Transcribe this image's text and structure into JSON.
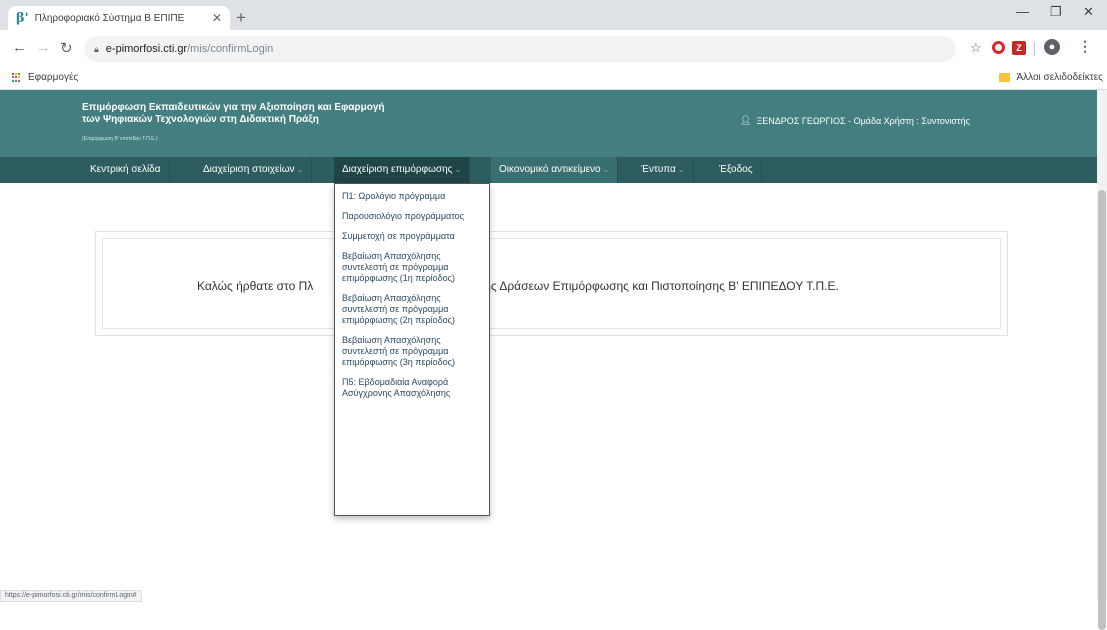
{
  "browser": {
    "tab": {
      "favicon_text": "β'",
      "title": "Πληροφοριακό Σύστημα Β ΕΠΙΠΕ"
    },
    "address": {
      "host": "e-pimorfosi.cti.gr",
      "path": "/mis/confirmLogin"
    },
    "bookmarks": {
      "apps_label": "Εφαρμογές",
      "other_label": "Άλλοι σελιδοδείκτες"
    },
    "status_url": "https://e-pimorfosi.cti.gr/mis/confirmLogin#"
  },
  "header": {
    "title_line1": "Επιμόρφωση Εκπαιδευτικών για την Αξιοποίηση και Εφαρμογή",
    "title_line2": "των Ψηφιακών Τεχνολογιών στη Διδακτική Πράξη",
    "subtitle": "(Επιμόρφωση Β' επιπέδου Τ.Π.Ε.)",
    "user_text": "ΞΕΝΔΡΟΣ ΓΕΩΡΓΙΟΣ - Ομάδα Χρήστη : Συντονιστής"
  },
  "nav": {
    "items": [
      {
        "label": "Κεντρική σελίδα",
        "has_chevron": false
      },
      {
        "label": "Διαχείριση στοιχείων",
        "has_chevron": true
      },
      {
        "label": "Διαχείριση επιμόρφωσης",
        "has_chevron": true
      },
      {
        "label": "Οικονομικό αντικείμενο",
        "has_chevron": true
      },
      {
        "label": "Έντυπα",
        "has_chevron": true
      },
      {
        "label": "Έξοδος",
        "has_chevron": false
      }
    ]
  },
  "dropdown": {
    "items": [
      "Π1: Ωρολόγιο πρόγραμμα",
      "Παρουσιολόγιο προγράμματος",
      "Συμμετοχή σε προγράμματα",
      "Βεβαίωση Απασχόλησης συντελεστή σε πρόγραμμα επιμόρφωσης (1η περίοδος)",
      "Βεβαίωση Απασχόλησης συντελεστή σε πρόγραμμα επιμόρφωσης (2η περίοδος)",
      "Βεβαίωση Απασχόλησης συντελεστή σε πρόγραμμα επιμόρφωσης (3η περίοδος)",
      "Π5: Εβδομαδιαία Αναφορά Ασύγχρονης Απασχόλησης"
    ]
  },
  "welcome": {
    "left_text": "Καλώς ήρθατε στο Πλ",
    "right_text": "είρισης Δράσεων Επιμόρφωσης και Πιστοποίησης Β' ΕΠΙΠΕΔΟΥ Τ.Π.Ε."
  },
  "colors": {
    "header_bg": "#437e80",
    "nav_bg": "#2e5d5f",
    "chevron": "#5cc2c7"
  }
}
